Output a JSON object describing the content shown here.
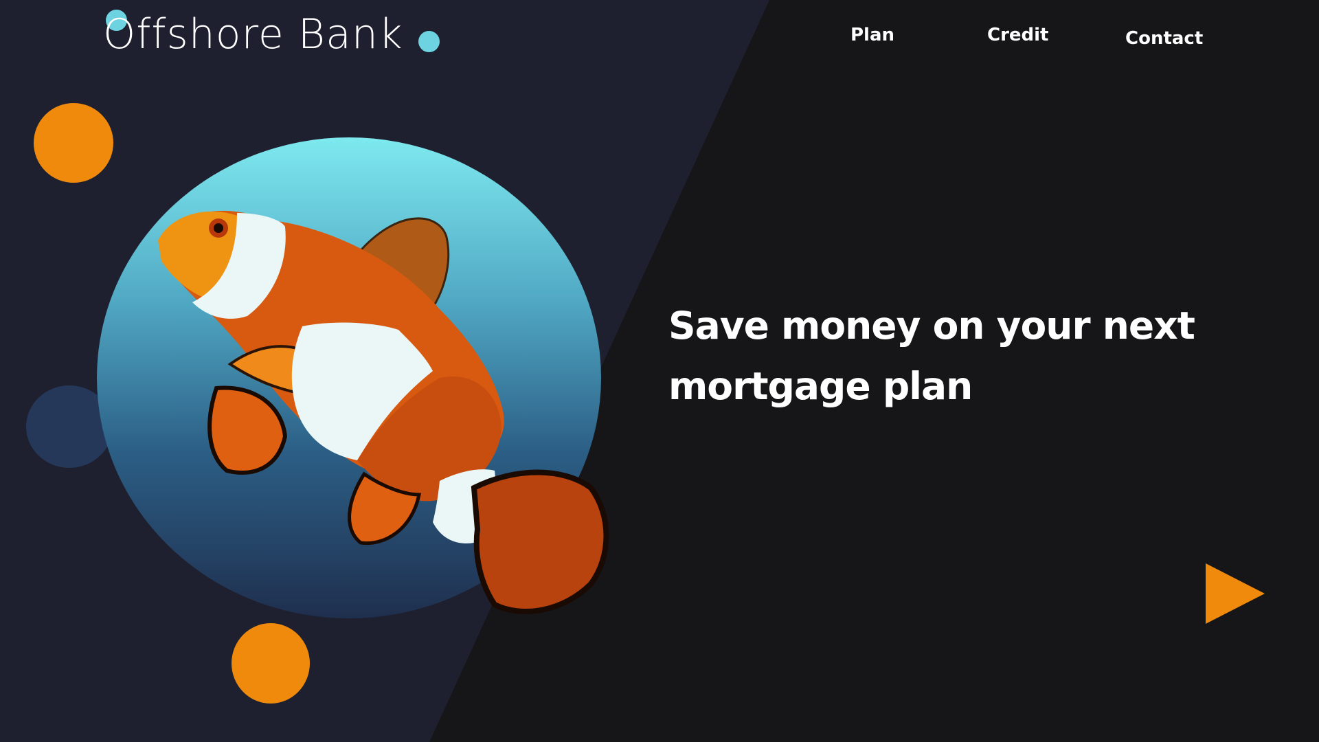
{
  "brand": {
    "name": "Offshore Bank"
  },
  "nav": {
    "items": [
      {
        "label": "Plan"
      },
      {
        "label": "Credit"
      },
      {
        "label": "Contact"
      }
    ]
  },
  "hero": {
    "headline": "Save money on your next mortgage plan",
    "image_icon": "clownfish-illustration",
    "action_icon": "play-triangle-icon"
  },
  "colors": {
    "dark_navy": "#1e2030",
    "near_black": "#161618",
    "orange": "#ef8a0c",
    "cyan": "#6dd3e0",
    "muted_blue": "#25385a",
    "white": "#ffffff"
  }
}
